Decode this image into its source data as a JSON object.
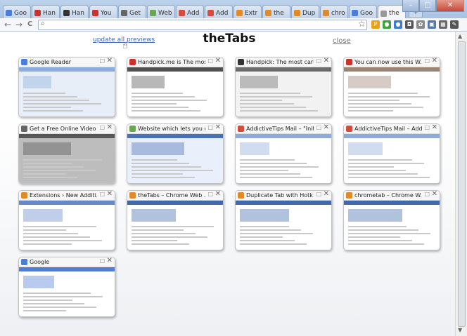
{
  "browser": {
    "tabs": [
      {
        "label": "Goo",
        "color": "#4a7ed8"
      },
      {
        "label": "Han",
        "color": "#c8342c"
      },
      {
        "label": "Han",
        "color": "#333333"
      },
      {
        "label": "You",
        "color": "#c8342c"
      },
      {
        "label": "Get",
        "color": "#666666"
      },
      {
        "label": "Web",
        "color": "#6aa84f"
      },
      {
        "label": "Add",
        "color": "#d44c3c"
      },
      {
        "label": "Add",
        "color": "#d44c3c"
      },
      {
        "label": "Extr",
        "color": "#e08a2a"
      },
      {
        "label": "the",
        "color": "#e08a2a"
      },
      {
        "label": "Dup",
        "color": "#e08a2a"
      },
      {
        "label": "chro",
        "color": "#e08a2a"
      },
      {
        "label": "Goo",
        "color": "#4a7ed8"
      },
      {
        "label": "the",
        "color": "#999999"
      }
    ],
    "new_tab_label": "+",
    "window_controls": {
      "minimize": "–",
      "maximize": "□",
      "close": "✕"
    }
  },
  "toolbar": {
    "back": "←",
    "forward": "→",
    "reload": "C",
    "omnibox_value": "",
    "extensions": [
      {
        "name": "ext-star-icon",
        "glyph": "P",
        "color": "#e6a117"
      },
      {
        "name": "ext-green-icon",
        "glyph": "●",
        "color": "#3aa33a"
      },
      {
        "name": "ext-blue-icon",
        "glyph": "●",
        "color": "#3b7bd4"
      },
      {
        "name": "ext-camera-icon",
        "glyph": "◘",
        "color": "#555555"
      },
      {
        "name": "ext-gear-icon",
        "glyph": "✿",
        "color": "#8a8a8a"
      },
      {
        "name": "ext-flag-icon",
        "glyph": "▣",
        "color": "#5577aa"
      },
      {
        "name": "ext-grid-icon",
        "glyph": "▦",
        "color": "#666666"
      },
      {
        "name": "ext-wrench-icon",
        "glyph": "✎",
        "color": "#555555"
      }
    ]
  },
  "page": {
    "title": "theTabs",
    "update_link": "update all previews",
    "close_link": "close"
  },
  "cards": [
    {
      "title": "Google Reader",
      "fav": "#4a7ed8",
      "theme": "#e8eef8",
      "accent": "#7aa0d8"
    },
    {
      "title": "Handpick.me is The most ...",
      "fav": "#c8342c",
      "theme": "#ffffff",
      "accent": "#333333"
    },
    {
      "title": "Handpick: The most cari...",
      "fav": "#333333",
      "theme": "#f2f2f2",
      "accent": "#555555"
    },
    {
      "title": "You can now use this W...",
      "fav": "#c8342c",
      "theme": "#ffffff",
      "accent": "#8a6e5a"
    },
    {
      "title": "Get a Free Online Video ...",
      "fav": "#666666",
      "theme": "#bdbdbd",
      "accent": "#444444"
    },
    {
      "title": "Website which lets you d...",
      "fav": "#6aa84f",
      "theme": "#eaf0fb",
      "accent": "#2f5aa8"
    },
    {
      "title": "AddictiveTips Mail – \"Init...",
      "fav": "#d44c3c",
      "theme": "#ffffff",
      "accent": "#7b9bd0"
    },
    {
      "title": "AddictiveTips Mail – Add...",
      "fav": "#d44c3c",
      "theme": "#ffffff",
      "accent": "#7b9bd0"
    },
    {
      "title": "Extensions › New Additi...",
      "fav": "#e08a2a",
      "theme": "#ffffff",
      "accent": "#4b74c0"
    },
    {
      "title": "theTabs – Chrome Web ...",
      "fav": "#e08a2a",
      "theme": "#ffffff",
      "accent": "#1d4f9c"
    },
    {
      "title": "Duplicate Tab with Hotk...",
      "fav": "#e08a2a",
      "theme": "#ffffff",
      "accent": "#1d4f9c"
    },
    {
      "title": "chrometab – Chrome W...",
      "fav": "#e08a2a",
      "theme": "#ffffff",
      "accent": "#1d4f9c"
    },
    {
      "title": "Google",
      "fav": "#4a7ed8",
      "theme": "#ffffff",
      "accent": "#3366cc"
    }
  ]
}
